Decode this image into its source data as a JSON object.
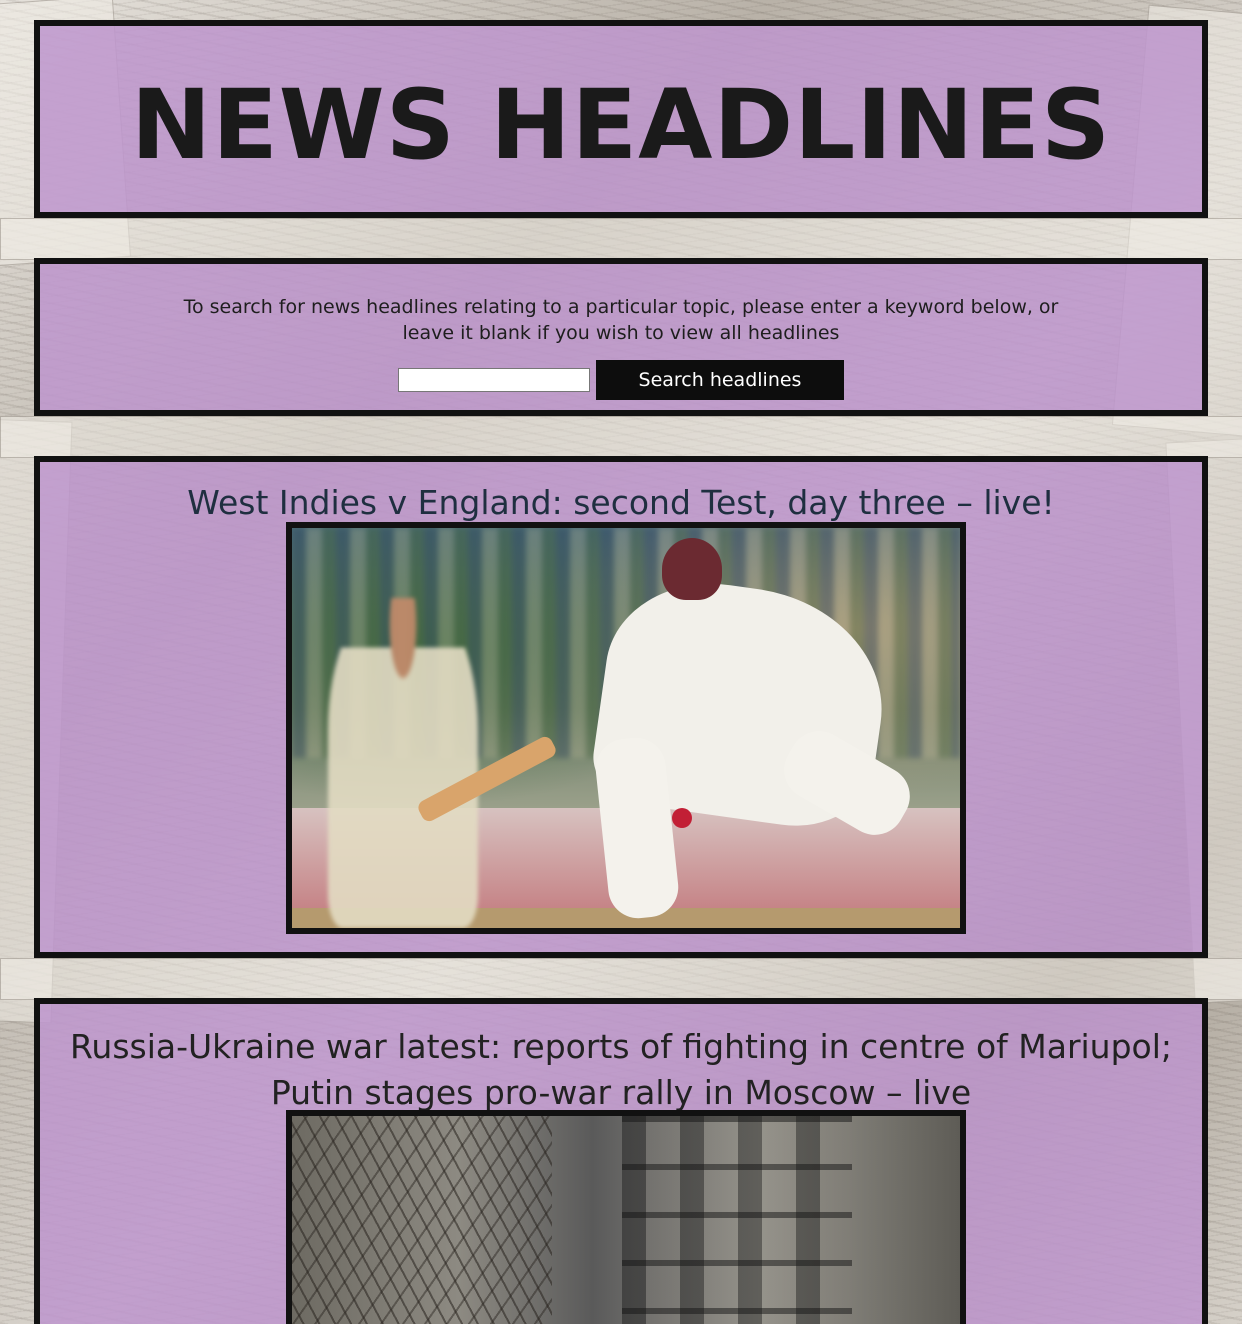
{
  "site": {
    "title": "NEWS HEADLINES"
  },
  "search": {
    "instructions_line1": "To search for news headlines relating to a particular topic, please enter a keyword below, or",
    "instructions_line2": "leave it blank if you wish to view all headlines",
    "input_value": "",
    "button_label": "Search headlines"
  },
  "articles": [
    {
      "headline": "West Indies v England: second Test, day three – live!",
      "image_icon": "cricket-photo"
    },
    {
      "headline_line1": "Russia-Ukraine war latest: reports of fighting in centre of Mariupol;",
      "headline_line2": "Putin stages pro-war rally in Moscow – live",
      "image_icon": "war-photo"
    }
  ],
  "colors": {
    "panel_background": "#be96cd",
    "panel_border": "#111111",
    "button_background": "#0d0d0d",
    "button_text": "#ffffff",
    "headline_1": "#1f2f40"
  }
}
